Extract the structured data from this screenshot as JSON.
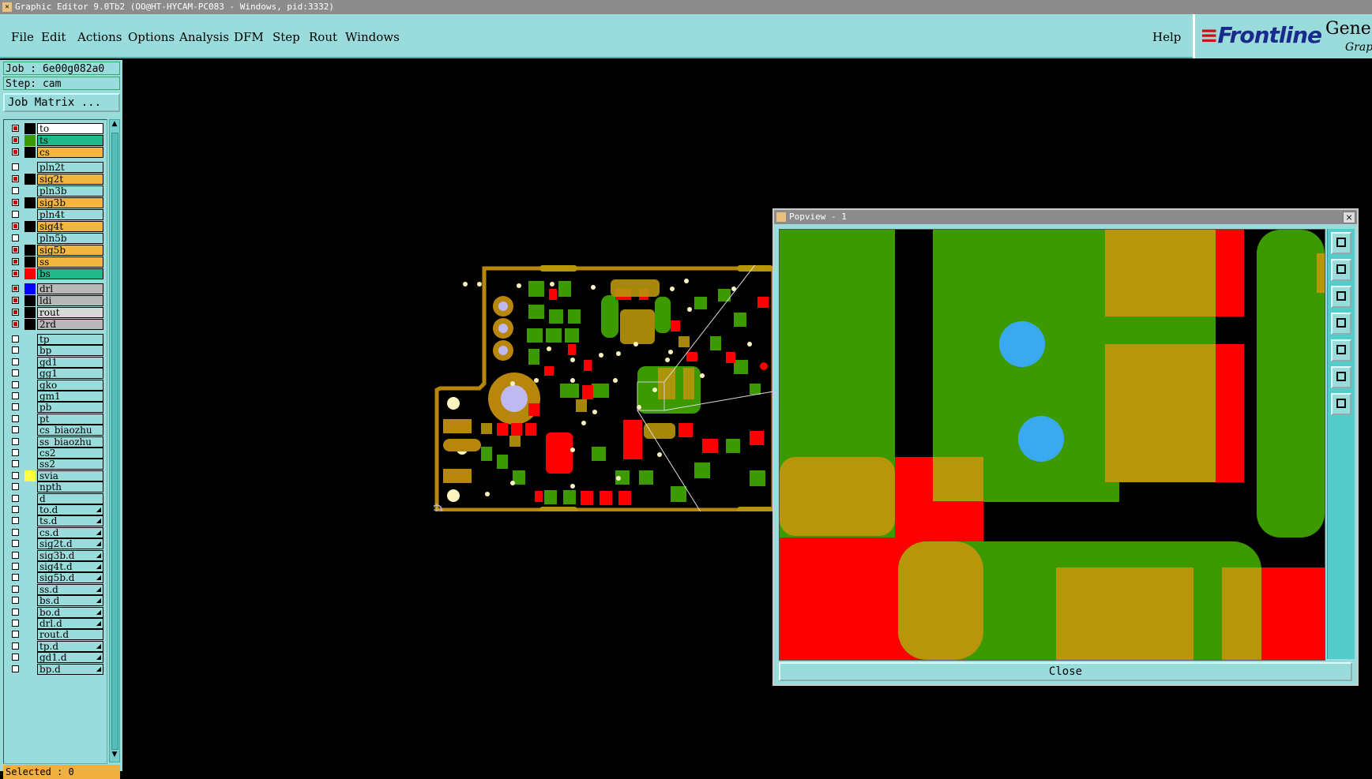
{
  "window": {
    "title": "Graphic Editor 9.0Tb2 (OO@HT-HYCAM-PC083 - Windows, pid:3332)"
  },
  "menu": {
    "items": [
      "File",
      "Edit",
      "Actions",
      "Options",
      "Analysis",
      "DFM",
      "Step",
      "Rout",
      "Windows"
    ],
    "help": "Help"
  },
  "brand": {
    "logo": "Frontline",
    "product": "Genes",
    "sub": "Graph"
  },
  "job": {
    "job_label": "Job : 6e00g082a0",
    "step_label": "Step: cam",
    "matrix_button": "Job Matrix ..."
  },
  "layers": [
    {
      "name": "to",
      "on": true,
      "swatch": "#000000",
      "bg": "#ffffff"
    },
    {
      "name": "ts",
      "on": true,
      "swatch": "#3c9a00",
      "bg": "#1fb98a"
    },
    {
      "name": "cs",
      "on": true,
      "swatch": "#000000",
      "bg": "#f2b640"
    },
    {
      "name": "pln2t",
      "on": false,
      "swatch": "",
      "bg": "#9adcdc"
    },
    {
      "name": "sig2t",
      "on": true,
      "swatch": "#000000",
      "bg": "#f2b640"
    },
    {
      "name": "pln3b",
      "on": false,
      "swatch": "",
      "bg": "#9adcdc"
    },
    {
      "name": "sig3b",
      "on": true,
      "swatch": "#000000",
      "bg": "#f2b640"
    },
    {
      "name": "pln4t",
      "on": false,
      "swatch": "",
      "bg": "#9adcdc"
    },
    {
      "name": "sig4t",
      "on": true,
      "swatch": "#000000",
      "bg": "#f2b640"
    },
    {
      "name": "pln5b",
      "on": false,
      "swatch": "",
      "bg": "#9adcdc"
    },
    {
      "name": "sig5b",
      "on": true,
      "swatch": "#000000",
      "bg": "#f2b640"
    },
    {
      "name": "ss",
      "on": true,
      "swatch": "#000000",
      "bg": "#f2b640"
    },
    {
      "name": "bs",
      "on": true,
      "swatch": "#ff0000",
      "bg": "#1fb98a"
    },
    {
      "name": "drl",
      "on": true,
      "swatch": "#0000ff",
      "bg": "#b8b8b8"
    },
    {
      "name": "ldi",
      "on": true,
      "swatch": "#000000",
      "bg": "#b8b8b8"
    },
    {
      "name": "rout",
      "on": true,
      "swatch": "#000000",
      "bg": "#d8d8d8"
    },
    {
      "name": "2rd",
      "on": true,
      "swatch": "#000000",
      "bg": "#b8b8b8"
    },
    {
      "name": "tp",
      "on": false,
      "swatch": "",
      "bg": "#9adcdc"
    },
    {
      "name": "bp",
      "on": false,
      "swatch": "",
      "bg": "#9adcdc"
    },
    {
      "name": "gd1",
      "on": false,
      "swatch": "",
      "bg": "#9adcdc"
    },
    {
      "name": "gg1",
      "on": false,
      "swatch": "",
      "bg": "#9adcdc"
    },
    {
      "name": "gko",
      "on": false,
      "swatch": "",
      "bg": "#9adcdc"
    },
    {
      "name": "gm1",
      "on": false,
      "swatch": "",
      "bg": "#9adcdc"
    },
    {
      "name": "pb",
      "on": false,
      "swatch": "",
      "bg": "#9adcdc"
    },
    {
      "name": "pt",
      "on": false,
      "swatch": "",
      "bg": "#9adcdc"
    },
    {
      "name": "cs_biaozhu",
      "on": false,
      "swatch": "",
      "bg": "#9adcdc"
    },
    {
      "name": "ss_biaozhu",
      "on": false,
      "swatch": "",
      "bg": "#9adcdc"
    },
    {
      "name": "cs2",
      "on": false,
      "swatch": "",
      "bg": "#9adcdc"
    },
    {
      "name": "ss2",
      "on": false,
      "swatch": "",
      "bg": "#9adcdc"
    },
    {
      "name": "svia",
      "on": false,
      "swatch": "#ffff40",
      "bg": "#9adcdc"
    },
    {
      "name": "npth",
      "on": false,
      "swatch": "",
      "bg": "#9adcdc"
    },
    {
      "name": "d",
      "on": false,
      "swatch": "",
      "bg": "#9adcdc"
    },
    {
      "name": "to.d",
      "on": false,
      "swatch": "",
      "bg": "#9adcdc",
      "arrow": true
    },
    {
      "name": "ts.d",
      "on": false,
      "swatch": "",
      "bg": "#9adcdc",
      "arrow": true
    },
    {
      "name": "cs.d",
      "on": false,
      "swatch": "",
      "bg": "#9adcdc",
      "arrow": true
    },
    {
      "name": "sig2t.d",
      "on": false,
      "swatch": "",
      "bg": "#9adcdc",
      "arrow": true
    },
    {
      "name": "sig3b.d",
      "on": false,
      "swatch": "",
      "bg": "#9adcdc",
      "arrow": true
    },
    {
      "name": "sig4t.d",
      "on": false,
      "swatch": "",
      "bg": "#9adcdc",
      "arrow": true
    },
    {
      "name": "sig5b.d",
      "on": false,
      "swatch": "",
      "bg": "#9adcdc",
      "arrow": true
    },
    {
      "name": "ss.d",
      "on": false,
      "swatch": "",
      "bg": "#9adcdc",
      "arrow": true
    },
    {
      "name": "bs.d",
      "on": false,
      "swatch": "",
      "bg": "#9adcdc",
      "arrow": true
    },
    {
      "name": "bo.d",
      "on": false,
      "swatch": "",
      "bg": "#9adcdc",
      "arrow": true
    },
    {
      "name": "drl.d",
      "on": false,
      "swatch": "",
      "bg": "#9adcdc",
      "arrow": true
    },
    {
      "name": "rout.d",
      "on": false,
      "swatch": "",
      "bg": "#9adcdc"
    },
    {
      "name": "tp.d",
      "on": false,
      "swatch": "",
      "bg": "#9adcdc",
      "arrow": true
    },
    {
      "name": "gd1.d",
      "on": false,
      "swatch": "",
      "bg": "#9adcdc",
      "arrow": true
    },
    {
      "name": "bp.d",
      "on": false,
      "swatch": "",
      "bg": "#9adcdc",
      "arrow": true
    }
  ],
  "status": {
    "selected": "Selected : 0"
  },
  "popview": {
    "title": "Popview - 1",
    "close_label": "Close",
    "close_x": "×"
  },
  "colors": {
    "green": "#3c9a00",
    "red": "#ff0000",
    "gold": "#b8960a",
    "blue": "#3aaaf0",
    "copper": "#b8860b"
  }
}
